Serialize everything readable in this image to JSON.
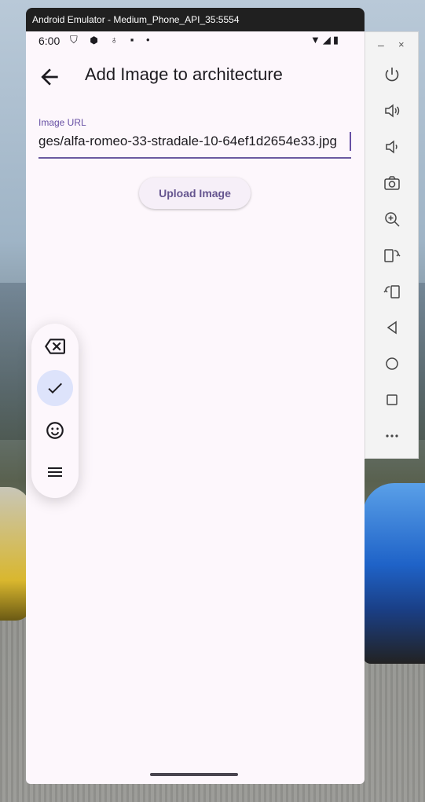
{
  "window": {
    "title": "Android Emulator - Medium_Phone_API_35:5554"
  },
  "statusbar": {
    "time": "6:00",
    "left_icons": "⛉ ⬢ ♁ ▪ •",
    "right_icons": "▼◢▮"
  },
  "appbar": {
    "title": "Add Image to architecture"
  },
  "form": {
    "image_url_label": "Image URL",
    "image_url_value": "ges/alfa-romeo-33-stradale-10-64ef1d2654e33.jpg"
  },
  "upload_button": {
    "label": "Upload Image"
  },
  "floating_toolbar": {
    "items": [
      "backspace-icon",
      "check-icon",
      "emoji-icon",
      "menu-icon"
    ]
  },
  "side_controls": {
    "minimize_label": "–",
    "close_label": "×",
    "buttons": [
      "power-icon",
      "volume-up-icon",
      "volume-down-icon",
      "camera-icon",
      "zoom-in-icon",
      "rotate-right-icon",
      "rotate-left-icon",
      "back-triangle-icon",
      "home-circle-icon",
      "overview-square-icon",
      "more-icon"
    ]
  },
  "colors": {
    "accent": "#6750a4",
    "surface": "#fdf7fc",
    "selected_chip": "#dde3fb"
  }
}
